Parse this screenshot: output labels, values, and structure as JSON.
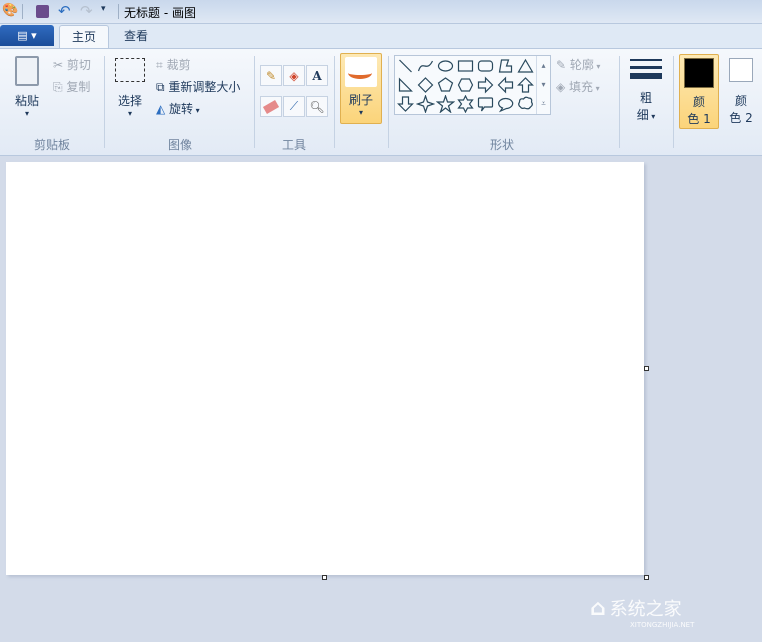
{
  "titlebar": {
    "title": "无标题 - 画图",
    "app_icon": "paint-palette-icon",
    "quick_access": [
      "save-icon",
      "undo-icon",
      "redo-icon",
      "customize-dropdown-icon"
    ]
  },
  "tabs": {
    "file_menu": "▤ ▾",
    "home": "主页",
    "view": "查看"
  },
  "clipboard": {
    "paste": "粘贴",
    "cut": "剪切",
    "copy": "复制",
    "group": "剪贴板"
  },
  "image": {
    "select": "选择",
    "crop": "裁剪",
    "resize": "重新调整大小",
    "rotate": "旋转",
    "group": "图像"
  },
  "tools": {
    "group": "工具",
    "items": [
      "pencil-icon",
      "fill-bucket-icon",
      "text-icon",
      "eraser-icon",
      "color-picker-icon",
      "magnifier-icon"
    ],
    "text_glyph": "A"
  },
  "brushes": {
    "label": "刷子"
  },
  "shapes": {
    "group": "形状",
    "outline": "轮廓",
    "fill": "填充",
    "items": [
      "line",
      "curve",
      "oval",
      "rectangle",
      "rounded-rectangle",
      "polygon",
      "triangle",
      "right-triangle",
      "diamond",
      "pentagon",
      "hexagon",
      "right-arrow",
      "left-arrow",
      "up-arrow",
      "down-arrow",
      "four-point-star",
      "five-point-star",
      "six-point-star",
      "rounded-callout",
      "oval-callout",
      "cloud-callout"
    ]
  },
  "size": {
    "label1": "粗",
    "label2": "细"
  },
  "colors": {
    "color1_l1": "颜",
    "color1_l2": "色 1",
    "color2_l1": "颜",
    "color2_l2": "色 2",
    "color1": "#000000",
    "color2": "#ffffff",
    "accent": "#fbd883"
  },
  "watermark": {
    "text": "系统之家",
    "sub": "XITONGZHIJIA.NET"
  }
}
